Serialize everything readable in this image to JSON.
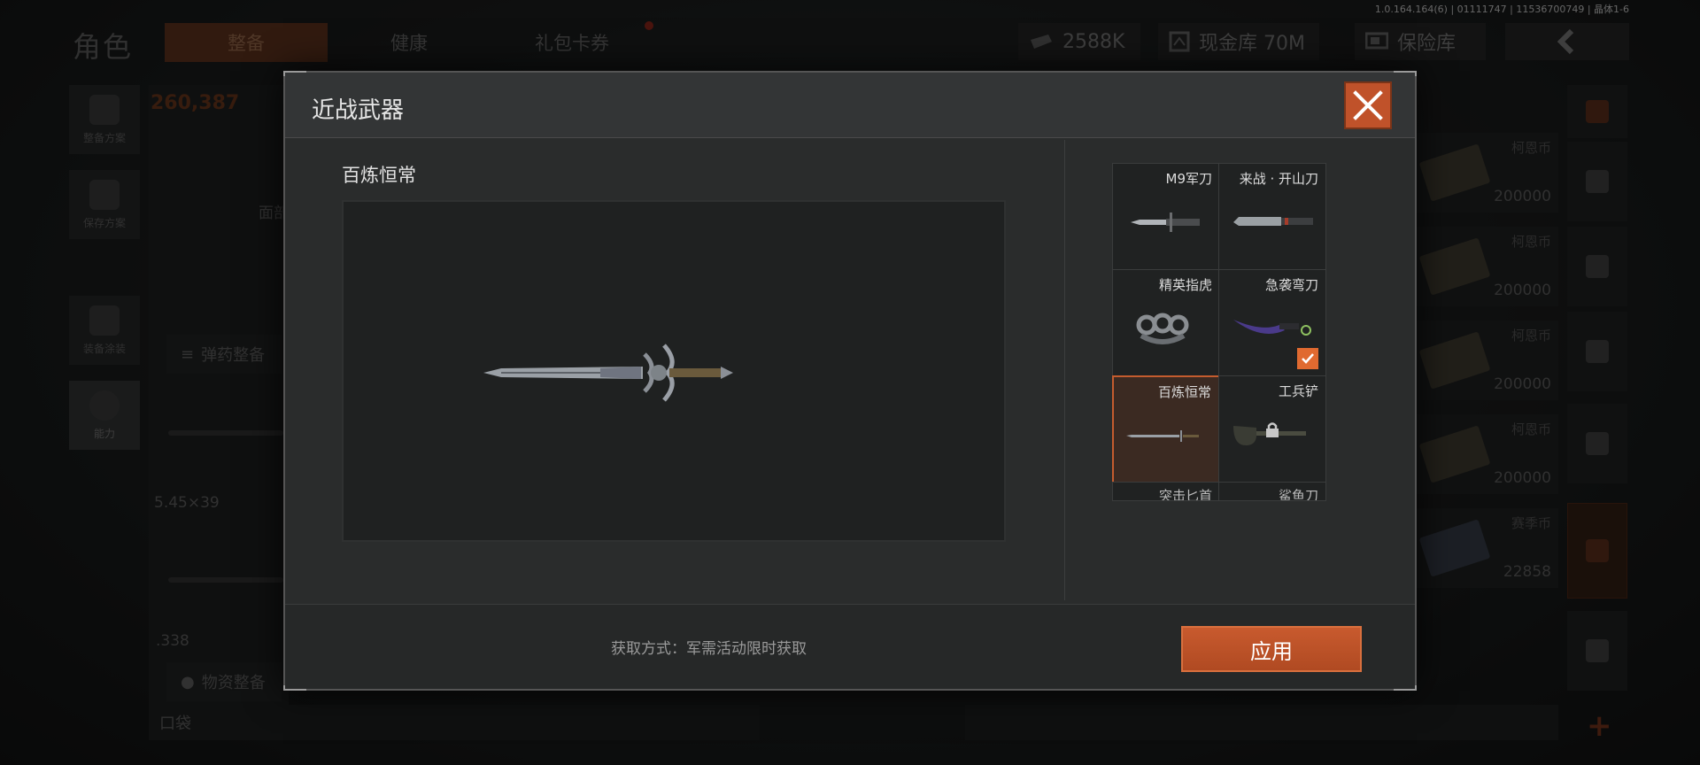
{
  "version": "1.0.164.164(6) | 01111747 | 11536700749 | 晶体1-6",
  "background": {
    "title": "角色",
    "tabs": [
      {
        "label": "整备",
        "active": true
      },
      {
        "label": "健康",
        "active": false
      },
      {
        "label": "礼包卡券",
        "active": false
      }
    ],
    "currency": {
      "value": "2588K",
      "icon": "ticket-icon"
    },
    "cash_vault": {
      "label": "现金库 70M",
      "icon": "vault-icon"
    },
    "safe": {
      "label": "保险库",
      "icon": "safe-icon"
    },
    "back_icon": "chevron-left-icon",
    "score": "260,387",
    "side_buttons": [
      {
        "label": "整备方案",
        "icon": "vest-icon"
      },
      {
        "label": "保存方案",
        "icon": "download-icon"
      },
      {
        "label": "装备涂装",
        "icon": "mask-icon"
      },
      {
        "label": "能力",
        "icon": "ability-icon",
        "active": true
      }
    ],
    "left_panel": {
      "face_label": "面部",
      "ammo_title": "弹药整备",
      "ammo_caliber_1": "5.45×39",
      "ammo_caliber_2": ".338",
      "supply_title": "物资整备",
      "pocket": "口袋"
    },
    "cash_items": [
      {
        "name": "柯恩币",
        "amount": "200000"
      },
      {
        "name": "柯恩币",
        "amount": "200000"
      },
      {
        "name": "柯恩币",
        "amount": "200000"
      },
      {
        "name": "柯恩币",
        "amount": "200000"
      },
      {
        "name": "赛季币",
        "amount": "22858"
      }
    ],
    "right_icons": [
      "stack-icon",
      "home-icon",
      "grenade-icon",
      "dice-icon",
      "key-icon",
      "box-icon",
      "package-icon",
      "plus-icon"
    ]
  },
  "modal": {
    "title": "近战武器",
    "close_icon": "close-icon",
    "preview_name": "百炼恒常",
    "acquire_text": "获取方式：军需活动限时获取",
    "apply_label": "应用",
    "items": [
      {
        "label": "M9军刀",
        "icon": "bayonet-icon",
        "selected": false,
        "equipped": false,
        "locked": false
      },
      {
        "label": "来战 · 开山刀",
        "icon": "machete-icon",
        "selected": false,
        "equipped": false,
        "locked": false
      },
      {
        "label": "精英指虎",
        "icon": "knuckles-icon",
        "selected": false,
        "equipped": false,
        "locked": false
      },
      {
        "label": "急袭弯刀",
        "icon": "karambit-icon",
        "selected": false,
        "equipped": true,
        "locked": false
      },
      {
        "label": "百炼恒常",
        "icon": "sword-icon",
        "selected": true,
        "equipped": false,
        "locked": false
      },
      {
        "label": "工兵铲",
        "icon": "shovel-icon",
        "selected": false,
        "equipped": false,
        "locked": true
      },
      {
        "label": "突击匕首",
        "icon": "dagger-icon",
        "selected": false,
        "equipped": false,
        "locked": false
      },
      {
        "label": "鲨鱼刀",
        "icon": "knife-icon",
        "selected": false,
        "equipped": false,
        "locked": false
      }
    ]
  }
}
